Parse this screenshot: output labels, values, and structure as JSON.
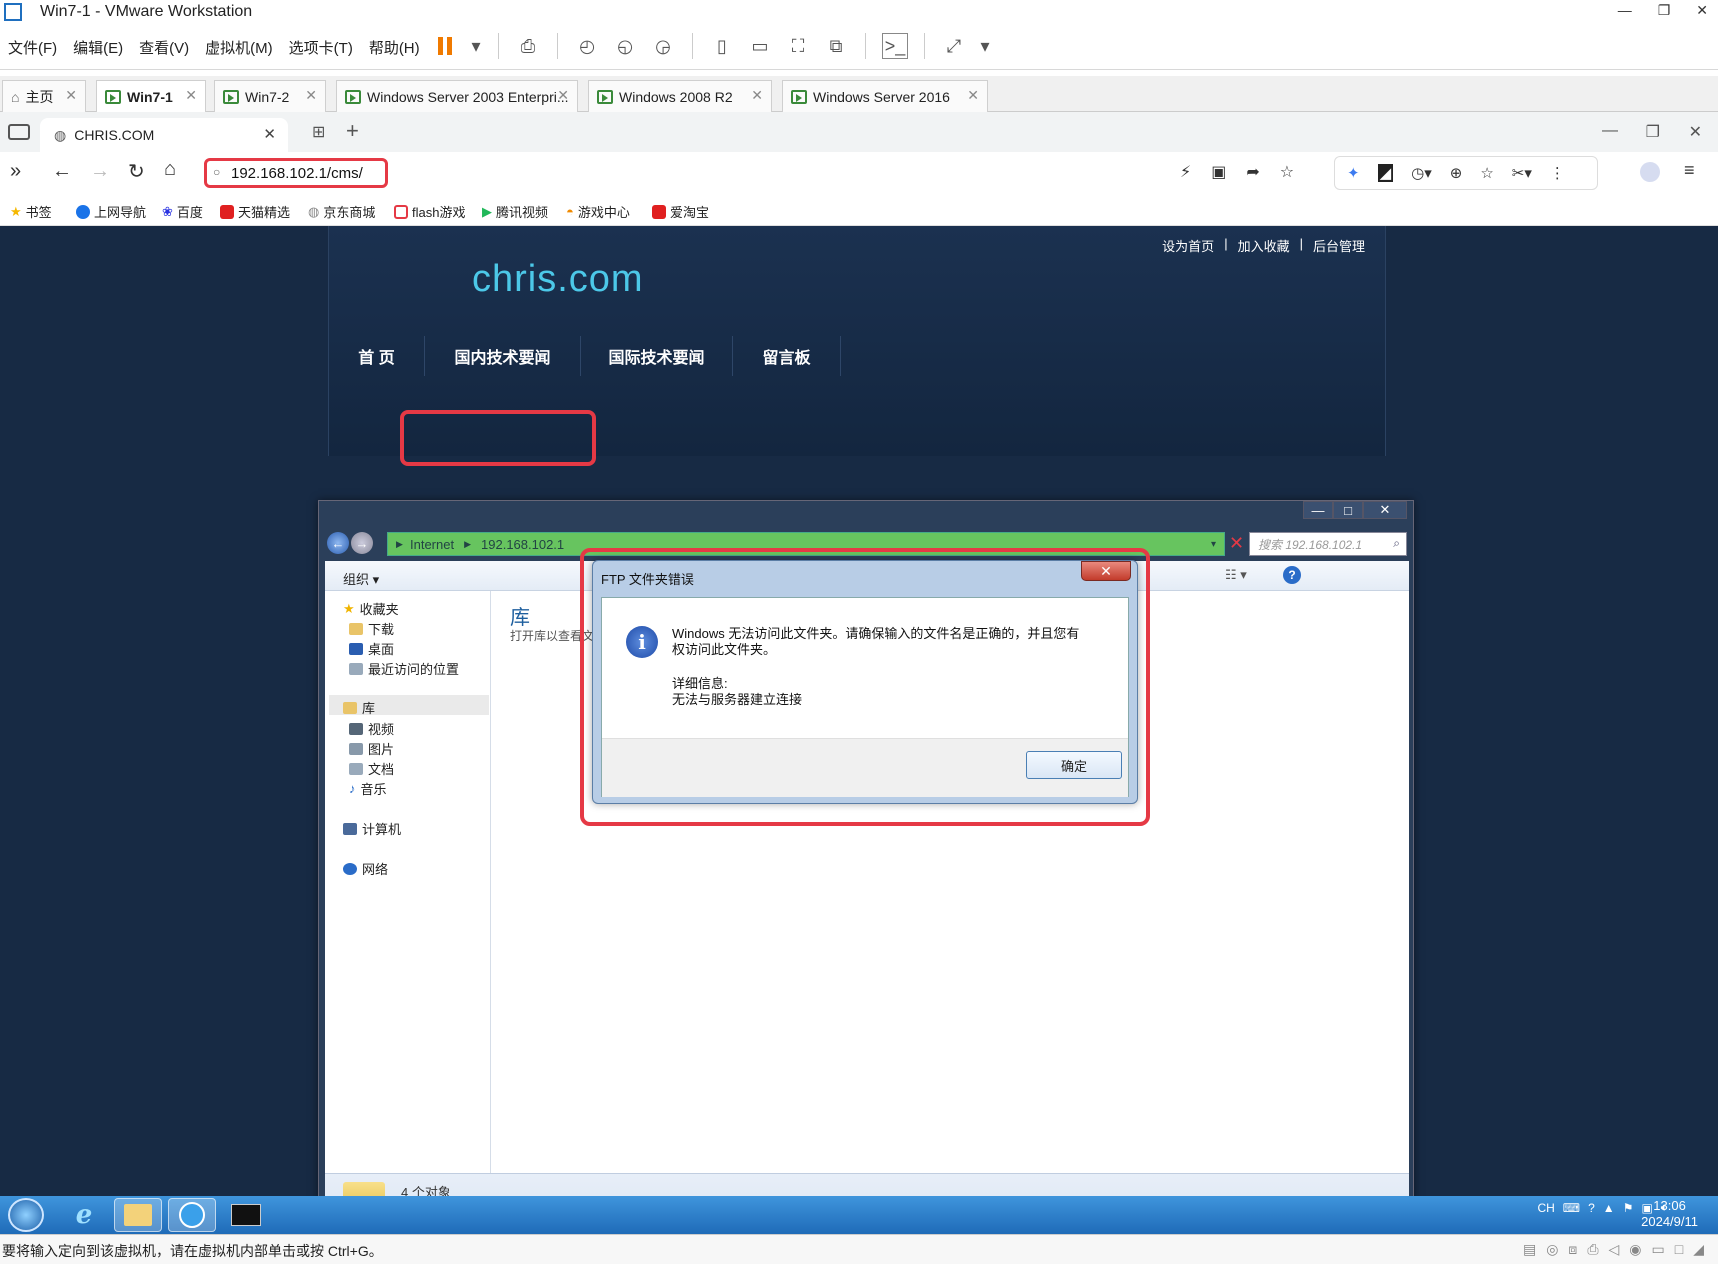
{
  "app": {
    "title": "Win7-1 - VMware Workstation"
  },
  "menu": [
    "文件(F)",
    "编辑(E)",
    "查看(V)",
    "虚拟机(M)",
    "选项卡(T)",
    "帮助(H)"
  ],
  "vm_tabs": [
    {
      "label": "主页"
    },
    {
      "label": "Win7-1",
      "active": true
    },
    {
      "label": "Win7-2"
    },
    {
      "label": "Windows Server 2003 Enterpri..."
    },
    {
      "label": "Windows 2008 R2"
    },
    {
      "label": "Windows Server 2016"
    }
  ],
  "browser": {
    "tab_title": "CHRIS.COM",
    "url": "192.168.102.1/cms/",
    "bookmarks": [
      {
        "label": "书签",
        "color": "#f5b800"
      },
      {
        "label": "上网导航",
        "color": "#1a73e8"
      },
      {
        "label": "百度",
        "color": "#2932e1"
      },
      {
        "label": "天猫精选",
        "color": "#e02020"
      },
      {
        "label": "京东商城",
        "color": "#888888"
      },
      {
        "label": "flash游戏",
        "color": "#e53945"
      },
      {
        "label": "腾讯视频",
        "color": "#21b85a"
      },
      {
        "label": "游戏中心",
        "color": "#f08a00"
      },
      {
        "label": "爱淘宝",
        "color": "#e02020"
      }
    ]
  },
  "site": {
    "links": [
      "设为首页",
      "|",
      "加入收藏",
      "|",
      "后台管理"
    ],
    "logo": "chris.com",
    "nav": [
      "首 页",
      "国内技术要闻",
      "国际技术要闻",
      "留言板"
    ]
  },
  "explorer": {
    "path": [
      "Internet",
      "192.168.102.1"
    ],
    "search_placeholder": "搜索 192.168.102.1",
    "organize": "组织 ▾",
    "tree": {
      "favorites": "收藏夹",
      "downloads": "下载",
      "desktop": "桌面",
      "recent": "最近访问的位置",
      "libraries": "库",
      "videos": "视频",
      "pictures": "图片",
      "documents": "文档",
      "music": "音乐",
      "computer": "计算机",
      "network": "网络"
    },
    "library_title": "库",
    "library_subtitle": "打开库以查看文件并根据文件夹、日期和其他属性排列这些文件。",
    "status": "4 个对象"
  },
  "dialog": {
    "title": "FTP 文件夹错误",
    "close": "✕",
    "message": "Windows 无法访问此文件夹。请确保输入的文件名是正确的，并且您有权访问此文件夹。",
    "detail_label": "详细信息:",
    "detail_text": "无法与服务器建立连接",
    "ok": "确定"
  },
  "taskbar": {
    "lang": "CH",
    "time": "13:06",
    "date": "2024/9/11"
  },
  "statusbar": {
    "message": "要将输入定向到该虚拟机，请在虚拟机内部单击或按 Ctrl+G。"
  },
  "colors": {
    "highlight": "#e53945",
    "logo": "#4cc8e8",
    "site_bg": "#172a44",
    "taskbar": "#2a7cc9",
    "path_green": "#67c45f"
  }
}
